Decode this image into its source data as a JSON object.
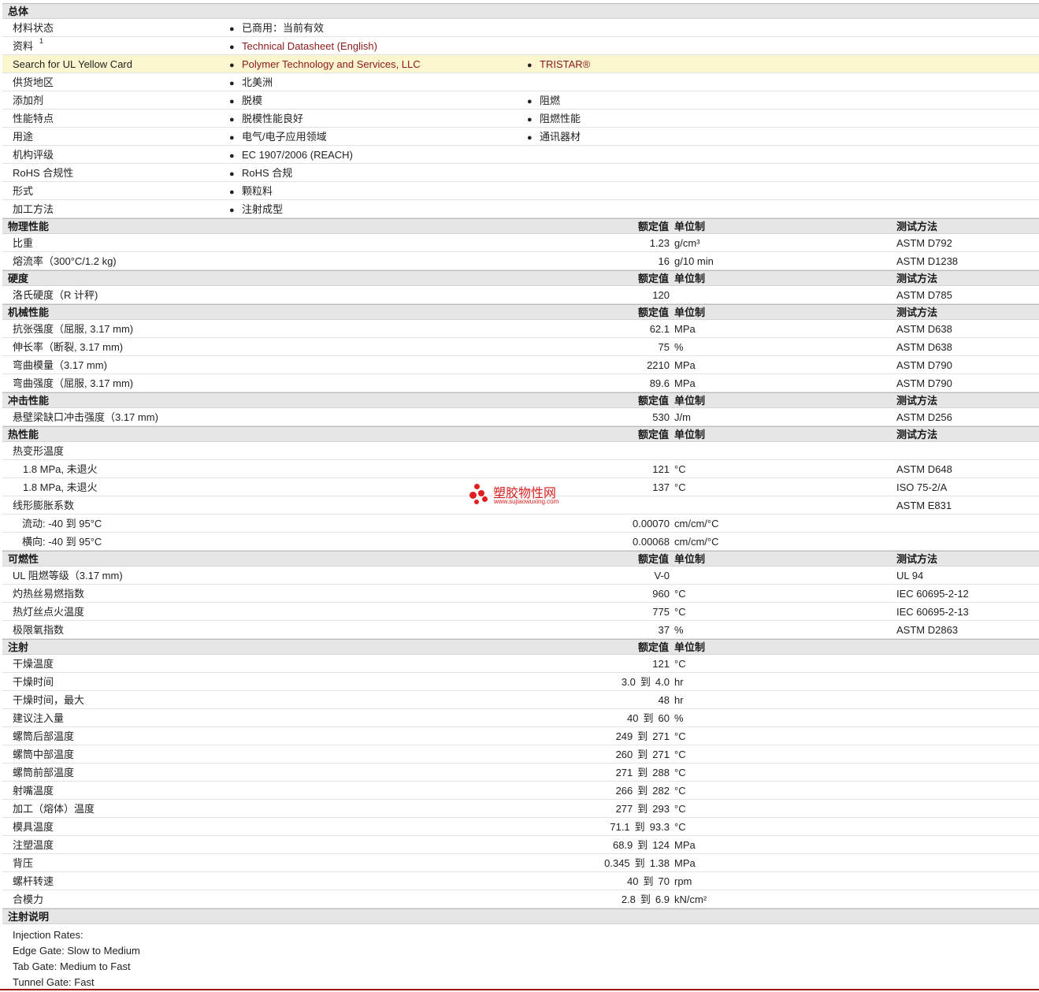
{
  "general": {
    "title": "总体",
    "rows": [
      {
        "label": "材料状态",
        "c1": "已商用：当前有效"
      },
      {
        "label": "资料",
        "sup": "1",
        "c1": "Technical Datasheet (English)",
        "c1_link": true
      },
      {
        "label": "Search for UL Yellow Card",
        "c1": "Polymer Technology and Services, LLC",
        "c1_link": true,
        "c2": "TRISTAR®",
        "c2_link": true,
        "highlight": true
      },
      {
        "label": "供货地区",
        "c1": "北美洲"
      },
      {
        "label": "添加剂",
        "c1": "脱模",
        "c2": "阻燃"
      },
      {
        "label": "性能特点",
        "c1": "脱模性能良好",
        "c2": "阻燃性能"
      },
      {
        "label": "用途",
        "c1": "电气/电子应用领域",
        "c2": "通讯器材"
      },
      {
        "label": "机构评级",
        "c1": "EC 1907/2006 (REACH)"
      },
      {
        "label": "RoHS 合规性",
        "c1": "RoHS 合规"
      },
      {
        "label": "形式",
        "c1": "颗粒料"
      },
      {
        "label": "加工方法",
        "c1": "注射成型"
      }
    ]
  },
  "headers": {
    "value": "额定值",
    "unit": "单位制",
    "method": "测试方法"
  },
  "sections": [
    {
      "title": "物理性能",
      "show_method": true,
      "rows": [
        {
          "label": "比重",
          "value": "1.23",
          "unit": "g/cm³",
          "method": "ASTM D792"
        },
        {
          "label": "熔流率（300°C/1.2 kg)",
          "value": "16",
          "unit": "g/10 min",
          "method": "ASTM D1238"
        }
      ]
    },
    {
      "title": "硬度",
      "show_method": true,
      "rows": [
        {
          "label": "洛氏硬度（R 计秤)",
          "value": "120",
          "unit": "",
          "method": "ASTM D785"
        }
      ]
    },
    {
      "title": "机械性能",
      "show_method": true,
      "rows": [
        {
          "label": "抗张强度（屈服, 3.17 mm)",
          "value": "62.1",
          "unit": "MPa",
          "method": "ASTM D638"
        },
        {
          "label": "伸长率（断裂, 3.17 mm)",
          "value": "75",
          "unit": "%",
          "method": "ASTM D638"
        },
        {
          "label": "弯曲模量（3.17 mm)",
          "value": "2210",
          "unit": "MPa",
          "method": "ASTM D790"
        },
        {
          "label": "弯曲强度（屈服, 3.17 mm)",
          "value": "89.6",
          "unit": "MPa",
          "method": "ASTM D790"
        }
      ]
    },
    {
      "title": "冲击性能",
      "show_method": true,
      "rows": [
        {
          "label": "悬壁梁缺口冲击强度（3.17 mm)",
          "value": "530",
          "unit": "J/m",
          "method": "ASTM D256"
        }
      ]
    },
    {
      "title": "热性能",
      "show_method": true,
      "rows": [
        {
          "label": "热变形温度",
          "value": "",
          "unit": "",
          "method": ""
        },
        {
          "label": "1.8 MPa, 未退火",
          "indent": 1,
          "value": "121",
          "unit": "°C",
          "method": "ASTM D648"
        },
        {
          "label": "1.8 MPa, 未退火",
          "indent": 1,
          "value": "137",
          "unit": "°C",
          "method": "ISO 75-2/A"
        },
        {
          "label": "线形膨胀系数",
          "value": "",
          "unit": "",
          "method": "ASTM E831"
        },
        {
          "label": "流动: -40 到  95°C",
          "indent": 2,
          "value": "0.00070",
          "unit": "cm/cm/°C",
          "method": ""
        },
        {
          "label": "横向: -40 到  95°C",
          "indent": 2,
          "value": "0.00068",
          "unit": "cm/cm/°C",
          "method": ""
        }
      ]
    },
    {
      "title": "可燃性",
      "show_method": true,
      "rows": [
        {
          "label": "UL 阻燃等级（3.17 mm)",
          "value": "V-0",
          "unit": "",
          "method": "UL 94"
        },
        {
          "label": "灼热丝易燃指数",
          "value": "960",
          "unit": "°C",
          "method": "IEC 60695-2-12"
        },
        {
          "label": "热灯丝点火温度",
          "value": "775",
          "unit": "°C",
          "method": "IEC 60695-2-13"
        },
        {
          "label": "极限氧指数",
          "value": "37",
          "unit": "%",
          "method": "ASTM D2863"
        }
      ]
    },
    {
      "title": "注射",
      "show_method": false,
      "rows": [
        {
          "label": "干燥温度",
          "value": "121",
          "unit": "°C"
        },
        {
          "label": "干燥时间",
          "v1": "3.0",
          "v2": "4.0",
          "unit": "hr"
        },
        {
          "label": "干燥时间，最大",
          "value": "48",
          "unit": "hr"
        },
        {
          "label": "建议注入量",
          "v1": "40",
          "v2": "60",
          "unit": "%"
        },
        {
          "label": "螺筒后部温度",
          "v1": "249",
          "v2": "271",
          "unit": "°C"
        },
        {
          "label": "螺筒中部温度",
          "v1": "260",
          "v2": "271",
          "unit": "°C"
        },
        {
          "label": "螺筒前部温度",
          "v1": "271",
          "v2": "288",
          "unit": "°C"
        },
        {
          "label": "射嘴温度",
          "v1": "266",
          "v2": "282",
          "unit": "°C"
        },
        {
          "label": "加工（熔体）温度",
          "v1": "277",
          "v2": "293",
          "unit": "°C"
        },
        {
          "label": "模具温度",
          "v1": "71.1",
          "v2": "93.3",
          "unit": "°C"
        },
        {
          "label": "注塑温度",
          "v1": "68.9",
          "v2": "124",
          "unit": "MPa"
        },
        {
          "label": "背压",
          "v1": "0.345",
          "v2": "1.38",
          "unit": "MPa"
        },
        {
          "label": "螺杆转速",
          "v1": "40",
          "v2": "70",
          "unit": "rpm"
        },
        {
          "label": "合模力",
          "v1": "2.8",
          "v2": "6.9",
          "unit": "kN/cm²"
        }
      ]
    }
  ],
  "range_word": "到",
  "notes": {
    "title": "注射说明",
    "lines": [
      "Injection Rates:",
      "Edge Gate: Slow to Medium",
      "Tab Gate: Medium to Fast",
      "Tunnel Gate: Fast"
    ]
  },
  "watermark": {
    "name": "塑胶物性网",
    "url": "www.sujiaowuxing.com"
  },
  "colors": {
    "link": "#8b1a1a",
    "highlight_row": "#fbf6cf",
    "section_header": "#e6e6e6",
    "watermark": "#d81e1e"
  }
}
